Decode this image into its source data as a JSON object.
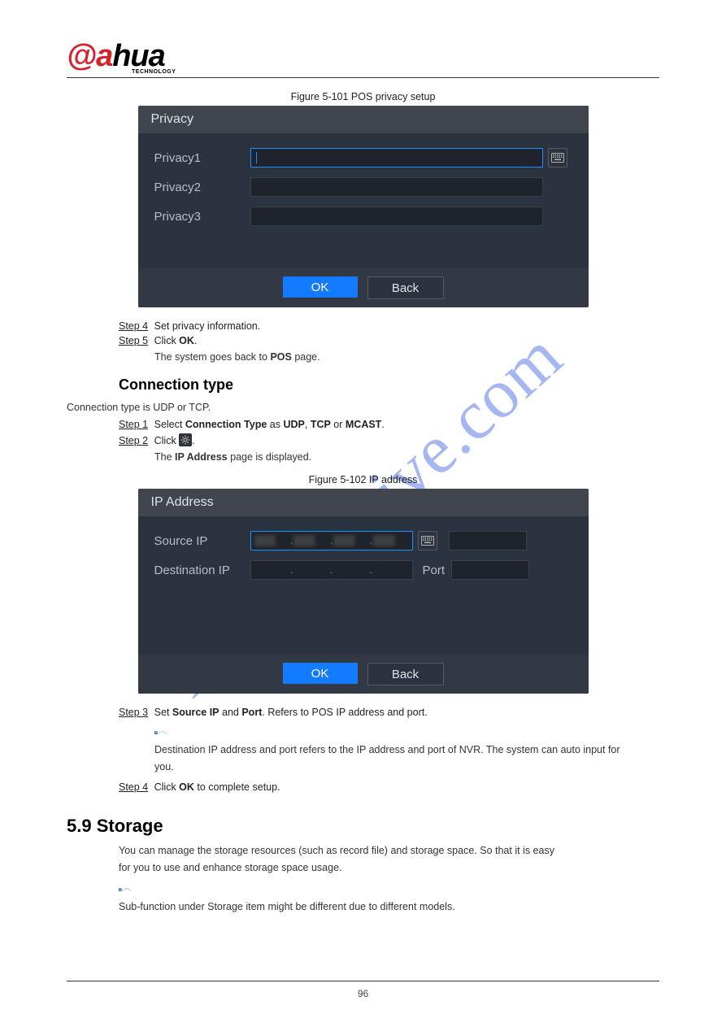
{
  "logo": {
    "brand_prefix": "a",
    "brand_rest": "hua",
    "sub": "TECHNOLOGY"
  },
  "watermark": "manualshive.com",
  "page_number": "96",
  "fig1": {
    "caption": "Figure 5-101 POS privacy setup"
  },
  "fig2": {
    "caption": "Figure 5-102 IP address"
  },
  "dialog1": {
    "title": "Privacy",
    "rows": [
      {
        "label": "Privacy1"
      },
      {
        "label": "Privacy2"
      },
      {
        "label": "Privacy3"
      }
    ],
    "ok": "OK",
    "back": "Back"
  },
  "dialog2": {
    "title": "IP Address",
    "source_label": "Source IP",
    "dest_label": "Destination IP",
    "port_label": "Port",
    "ok": "OK",
    "back": "Back"
  },
  "blockA": {
    "step4_num": "Step 4",
    "step4_txt": " Set privacy information.",
    "step5_num": "Step 5",
    "step5_txt_a": " Click ",
    "step5_bold": "OK",
    "step5_txt_b": ".",
    "step5_sys": "The system goes back to ",
    "step5_bold2": "POS",
    "step5_sys2": " page.",
    "h3": "Connection type",
    "conn_para": "Connection type is UDP or TCP.",
    "sA_num": "Step 1",
    "sA_a": " Select ",
    "sA_b1": "Connection Type",
    "sA_mid": " as ",
    "sA_b2": "UDP",
    "sA_sep": ", ",
    "sA_b3": "TCP",
    "sA_or": " or ",
    "sA_b4": "MCAST",
    "sA_end": ".",
    "sB_num": "Step 2",
    "sB_a": " Click ",
    "sB_end": ".",
    "sB_sys_a": "The ",
    "sB_sys_b": "IP Address",
    "sB_sys_c": " page is displayed."
  },
  "blockB": {
    "s3_num": "Step 3",
    "s3_a": " Set ",
    "s3_b1": "Source IP",
    "s3_mid": " and ",
    "s3_b2": "Port",
    "s3_end": ". Refers to POS IP address and port.",
    "note_para_a": "Destination IP address and port refers to the IP address and port of NVR. The system can auto input for",
    "note_para_b": "you.",
    "s4_num": "Step 4",
    "s4_a": " Click ",
    "s4_b": "OK",
    "s4_mid": " to complete setup.",
    "h3": "5.9 Storage",
    "storage_para": "You can manage the storage resources (such as record file) and storage space. So that it is easy",
    "storage_para2": "for you to use and enhance storage space usage.",
    "note_text": "Sub-function under Storage item might be different due to different models."
  }
}
